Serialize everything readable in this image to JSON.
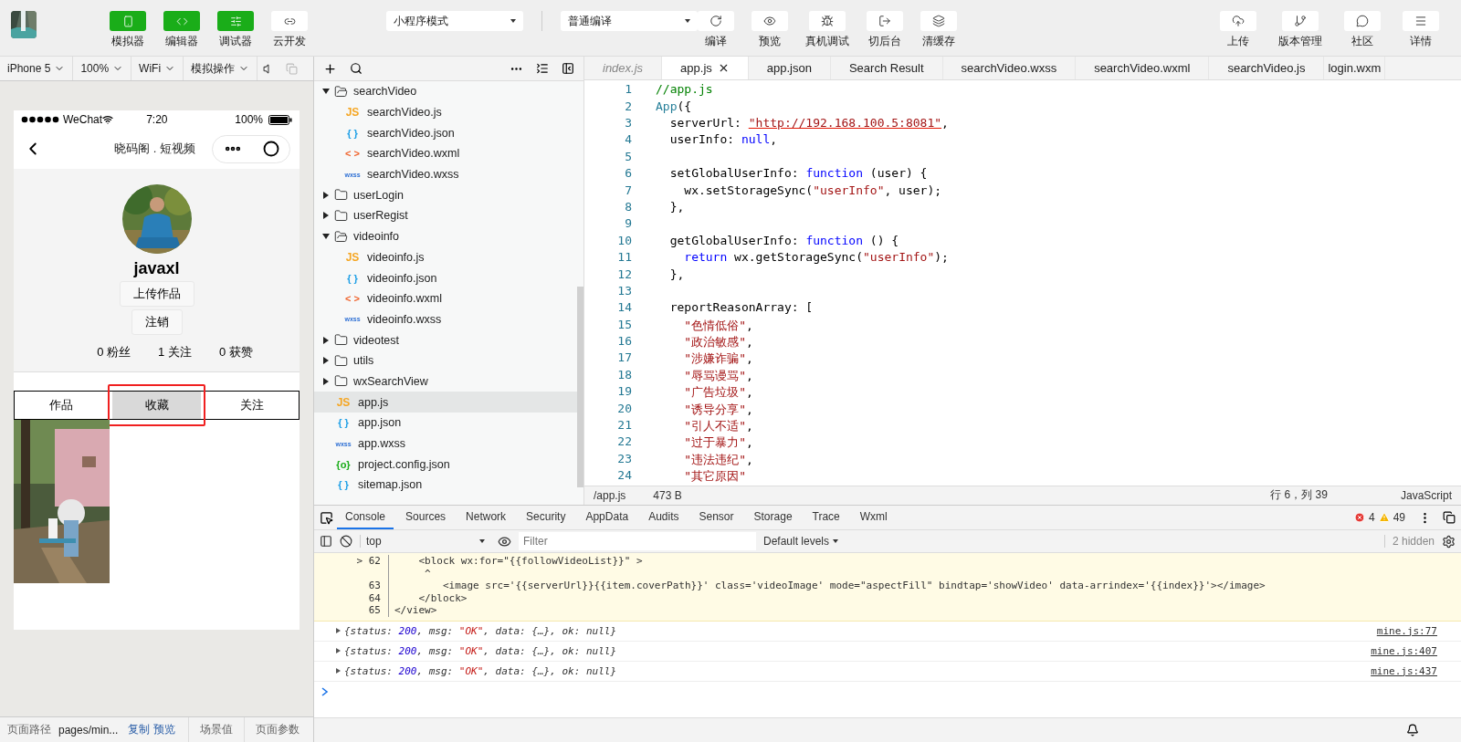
{
  "toolbar": {
    "mode_buttons": [
      {
        "label": "模拟器",
        "active": true
      },
      {
        "label": "编辑器",
        "active": true
      },
      {
        "label": "调试器",
        "active": true
      },
      {
        "label": "云开发",
        "active": false
      }
    ],
    "mode_select": "小程序模式",
    "compile_select": "普通编译",
    "actions": [
      "编译",
      "预览",
      "真机调试",
      "切后台",
      "清缓存"
    ],
    "right_actions": [
      "上传",
      "版本管理",
      "社区",
      "详情"
    ]
  },
  "simulator": {
    "options": [
      "iPhone 5",
      "100%",
      "WiFi",
      "模拟操作"
    ],
    "phone": {
      "carrier": "WeChat",
      "time": "7:20",
      "battery": "100%",
      "nav_title": "晓码阁 . 短视频",
      "username": "javaxl",
      "buttons": [
        "上传作品",
        "注销"
      ],
      "stats": [
        "0 粉丝",
        "1 关注",
        "0 获赞"
      ],
      "tabs": [
        {
          "label": "作品",
          "selected": false,
          "highlighted": false
        },
        {
          "label": "收藏",
          "selected": true,
          "highlighted": true
        },
        {
          "label": "关注",
          "selected": false,
          "highlighted": false
        }
      ],
      "videos": [
        {
          "kind": "picture"
        }
      ]
    },
    "path_bar": {
      "label": "页面路径",
      "path": "pages/min...",
      "links": [
        "复制",
        "预览"
      ],
      "buttons": [
        "场景值",
        "页面参数"
      ]
    }
  },
  "file_tree": [
    {
      "children": [
        {
          "name": "searchVideo",
          "kind": "folder",
          "expanded": true,
          "selected": false,
          "children": [
            {
              "name": "searchVideo.js",
              "kind": "js",
              "glyph": "JS",
              "selected": false
            },
            {
              "name": "searchVideo.json",
              "kind": "json",
              "glyph": "{ }",
              "selected": false
            },
            {
              "name": "searchVideo.wxml",
              "kind": "wxml",
              "glyph": "< >",
              "selected": false
            },
            {
              "name": "searchVideo.wxss",
              "kind": "wxss",
              "glyph": "wxss",
              "selected": false
            }
          ]
        },
        {
          "name": "userLogin",
          "kind": "folder",
          "expanded": false,
          "selected": false
        },
        {
          "name": "userRegist",
          "kind": "folder",
          "expanded": false,
          "selected": false
        },
        {
          "name": "videoinfo",
          "kind": "folder",
          "expanded": true,
          "selected": false,
          "children": [
            {
              "name": "videoinfo.js",
              "kind": "js",
              "glyph": "JS",
              "selected": false
            },
            {
              "name": "videoinfo.json",
              "kind": "json",
              "glyph": "{ }",
              "selected": false
            },
            {
              "name": "videoinfo.wxml",
              "kind": "wxml",
              "glyph": "< >",
              "selected": false
            },
            {
              "name": "videoinfo.wxss",
              "kind": "wxss",
              "glyph": "wxss",
              "selected": false
            }
          ]
        },
        {
          "name": "videotest",
          "kind": "folder",
          "expanded": false,
          "selected": false
        }
      ]
    },
    {
      "name": "utils",
      "kind": "folder",
      "expanded": false,
      "selected": false
    },
    {
      "name": "wxSearchView",
      "kind": "folder",
      "expanded": false,
      "selected": false
    },
    {
      "name": "app.js",
      "kind": "js",
      "glyph": "JS",
      "selected": true
    },
    {
      "name": "app.json",
      "kind": "json",
      "glyph": "{ }",
      "selected": false
    },
    {
      "name": "app.wxss",
      "kind": "wxss",
      "glyph": "wxss",
      "selected": false
    },
    {
      "name": "project.config.json",
      "kind": "config",
      "glyph": "{o}",
      "selected": false
    },
    {
      "name": "sitemap.json",
      "kind": "json",
      "glyph": "{ }",
      "selected": false
    }
  ],
  "editor": {
    "tabs": [
      {
        "label": "index.js",
        "selected": false,
        "preview": true
      },
      {
        "label": "app.js",
        "selected": true,
        "preview": false
      },
      {
        "label": "app.json",
        "selected": false,
        "preview": false
      },
      {
        "label": "Search Result",
        "selected": false,
        "preview": false
      },
      {
        "label": "searchVideo.wxss",
        "selected": false,
        "preview": false
      },
      {
        "label": "searchVideo.wxml",
        "selected": false,
        "preview": false
      },
      {
        "label": "searchVideo.js",
        "selected": false,
        "preview": false
      },
      {
        "label": "login.wxm",
        "selected": false,
        "preview": false
      }
    ],
    "lines": [
      {
        "number": "1",
        "tokens": [
          {
            "text": "//app.js",
            "kind": "comment"
          }
        ]
      },
      {
        "number": "2",
        "tokens": [
          {
            "text": "App",
            "kind": "type"
          },
          {
            "text": "({",
            "kind": "plain"
          }
        ]
      },
      {
        "number": "3",
        "tokens": [
          {
            "text": "  serverUrl: ",
            "kind": "plain"
          },
          {
            "text": "\"http://192.168.100.5:8081\"",
            "kind": "url"
          },
          {
            "text": ",",
            "kind": "plain"
          }
        ]
      },
      {
        "number": "4",
        "tokens": [
          {
            "text": "  userInfo: ",
            "kind": "plain"
          },
          {
            "text": "null",
            "kind": "keyword"
          },
          {
            "text": ",",
            "kind": "plain"
          }
        ]
      },
      {
        "number": "5"
      },
      {
        "number": "6",
        "tokens": [
          {
            "text": "  setGlobalUserInfo: ",
            "kind": "plain"
          },
          {
            "text": "function",
            "kind": "keyword"
          },
          {
            "text": " (user) {",
            "kind": "plain"
          }
        ]
      },
      {
        "number": "7",
        "tokens": [
          {
            "text": "    wx.setStorageSync(",
            "kind": "plain"
          },
          {
            "text": "\"userInfo\"",
            "kind": "string"
          },
          {
            "text": ", user);",
            "kind": "plain"
          }
        ]
      },
      {
        "number": "8",
        "tokens": [
          {
            "text": "  },",
            "kind": "plain"
          }
        ]
      },
      {
        "number": "9"
      },
      {
        "number": "10",
        "tokens": [
          {
            "text": "  getGlobalUserInfo: ",
            "kind": "plain"
          },
          {
            "text": "function",
            "kind": "keyword"
          },
          {
            "text": " () {",
            "kind": "plain"
          }
        ]
      },
      {
        "number": "11",
        "tokens": [
          {
            "text": "    return",
            "kind": "keyword"
          },
          {
            "text": " wx.getStorageSync(",
            "kind": "plain"
          },
          {
            "text": "\"userInfo\"",
            "kind": "string"
          },
          {
            "text": ");",
            "kind": "plain"
          }
        ]
      },
      {
        "number": "12",
        "tokens": [
          {
            "text": "  },",
            "kind": "plain"
          }
        ]
      },
      {
        "number": "13"
      },
      {
        "number": "14",
        "tokens": [
          {
            "text": "  reportReasonArray: [",
            "kind": "plain"
          }
        ]
      },
      {
        "number": "15",
        "tokens": [
          {
            "text": "    \"色情低俗\"",
            "kind": "string"
          },
          {
            "text": ",",
            "kind": "plain"
          }
        ]
      },
      {
        "number": "16",
        "tokens": [
          {
            "text": "    \"政治敏感\"",
            "kind": "string"
          },
          {
            "text": ",",
            "kind": "plain"
          }
        ]
      },
      {
        "number": "17",
        "tokens": [
          {
            "text": "    \"涉嫌诈骗\"",
            "kind": "string"
          },
          {
            "text": ",",
            "kind": "plain"
          }
        ]
      },
      {
        "number": "18",
        "tokens": [
          {
            "text": "    \"辱骂谩骂\"",
            "kind": "string"
          },
          {
            "text": ",",
            "kind": "plain"
          }
        ]
      },
      {
        "number": "19",
        "tokens": [
          {
            "text": "    \"广告垃圾\"",
            "kind": "string"
          },
          {
            "text": ",",
            "kind": "plain"
          }
        ]
      },
      {
        "number": "20",
        "tokens": [
          {
            "text": "    \"诱导分享\"",
            "kind": "string"
          },
          {
            "text": ",",
            "kind": "plain"
          }
        ]
      },
      {
        "number": "21",
        "tokens": [
          {
            "text": "    \"引人不适\"",
            "kind": "string"
          },
          {
            "text": ",",
            "kind": "plain"
          }
        ]
      },
      {
        "number": "22",
        "tokens": [
          {
            "text": "    \"过于暴力\"",
            "kind": "string"
          },
          {
            "text": ",",
            "kind": "plain"
          }
        ]
      },
      {
        "number": "23",
        "tokens": [
          {
            "text": "    \"违法违纪\"",
            "kind": "string"
          },
          {
            "text": ",",
            "kind": "plain"
          }
        ]
      },
      {
        "number": "24",
        "tokens": [
          {
            "text": "    \"其它原因\"",
            "kind": "string"
          }
        ]
      }
    ],
    "status": {
      "path": "/app.js",
      "size": "473 B",
      "position": "行 6，列 39",
      "language": "JavaScript"
    }
  },
  "console": {
    "tabs": [
      {
        "label": "Console",
        "selected": true
      },
      {
        "label": "Sources",
        "selected": false
      },
      {
        "label": "Network",
        "selected": false
      },
      {
        "label": "Security",
        "selected": false
      },
      {
        "label": "AppData",
        "selected": false
      },
      {
        "label": "Audits",
        "selected": false
      },
      {
        "label": "Sensor",
        "selected": false
      },
      {
        "label": "Storage",
        "selected": false
      },
      {
        "label": "Trace",
        "selected": false
      },
      {
        "label": "Wxml",
        "selected": false
      }
    ],
    "errors": "4",
    "warnings": "49",
    "context": "top",
    "filter_placeholder": "Filter",
    "levels": "Default levels",
    "hidden": "2 hidden",
    "snippet": [
      {
        "gutter": "> 62",
        "code": "    <block wx:for=\"{{followVideoList}}\" >"
      },
      {
        "code": "     ^"
      },
      {
        "gutter": "63",
        "code": "        <image src='{{serverUrl}}{{item.coverPath}}' class='videoImage' mode=\"aspectFill\" bindtap='showVideo' data-arrindex='{{index}}'></image>"
      },
      {
        "gutter": "64",
        "code": "    </block>"
      },
      {
        "gutter": "65",
        "code": "</view>"
      }
    ],
    "logs": [
      {
        "tokens": [
          {
            "text": "{status: ",
            "kind": "plain"
          },
          {
            "text": "200",
            "kind": "number"
          },
          {
            "text": ", msg: ",
            "kind": "plain"
          },
          {
            "text": "\"OK\"",
            "kind": "string"
          },
          {
            "text": ", data: {…}, ok: null}",
            "kind": "plain"
          }
        ],
        "source": "mine.js:77"
      },
      {
        "tokens": [
          {
            "text": "{status: ",
            "kind": "plain"
          },
          {
            "text": "200",
            "kind": "number"
          },
          {
            "text": ", msg: ",
            "kind": "plain"
          },
          {
            "text": "\"OK\"",
            "kind": "string"
          },
          {
            "text": ", data: {…}, ok: null}",
            "kind": "plain"
          }
        ],
        "source": "mine.js:407"
      },
      {
        "tokens": [
          {
            "text": "{status: ",
            "kind": "plain"
          },
          {
            "text": "200",
            "kind": "number"
          },
          {
            "text": ", msg: ",
            "kind": "plain"
          },
          {
            "text": "\"OK\"",
            "kind": "string"
          },
          {
            "text": ", data: {…}, ok: null}",
            "kind": "plain"
          }
        ],
        "source": "mine.js:437"
      }
    ]
  }
}
